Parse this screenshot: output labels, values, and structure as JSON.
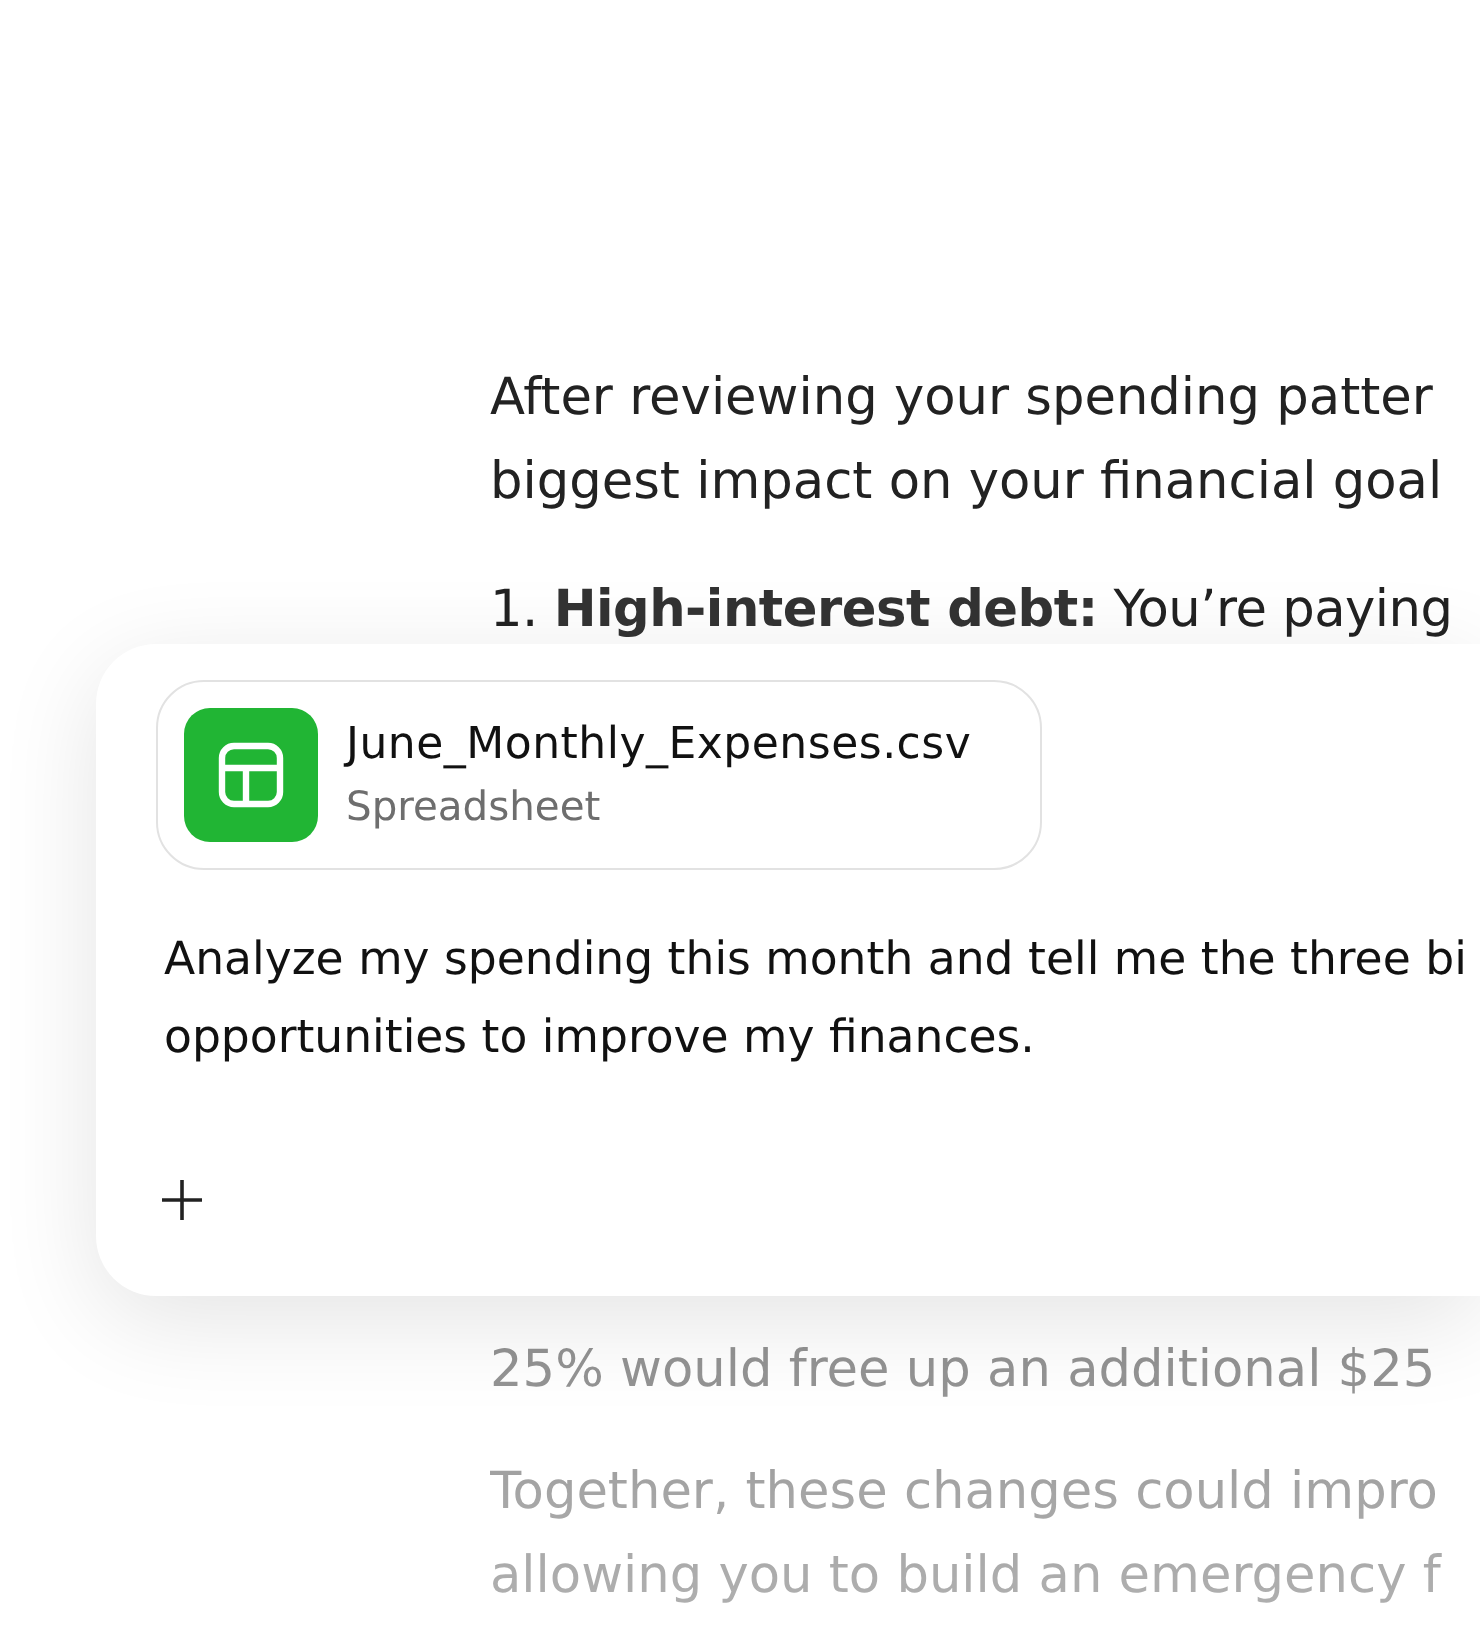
{
  "response": {
    "intro_lines": [
      "After reviewing your spending patter",
      "biggest impact on your financial goal"
    ],
    "list_item": "1. **High-interest debt:** You’re paying",
    "lower_paragraphs": [
      {
        "lines": [
          "25% would free up an additional $25"
        ]
      },
      {
        "lines": [
          "Together, these changes could impro",
          "allowing you to build an emergency f"
        ]
      }
    ]
  },
  "composer": {
    "attachment": {
      "file_name": "June_Monthly_Expenses.csv",
      "file_type": "Spreadsheet"
    },
    "message": {
      "value_lines": [
        "Analyze my spending this month and tell me the three bi",
        "opportunities to improve my finances."
      ]
    }
  }
}
